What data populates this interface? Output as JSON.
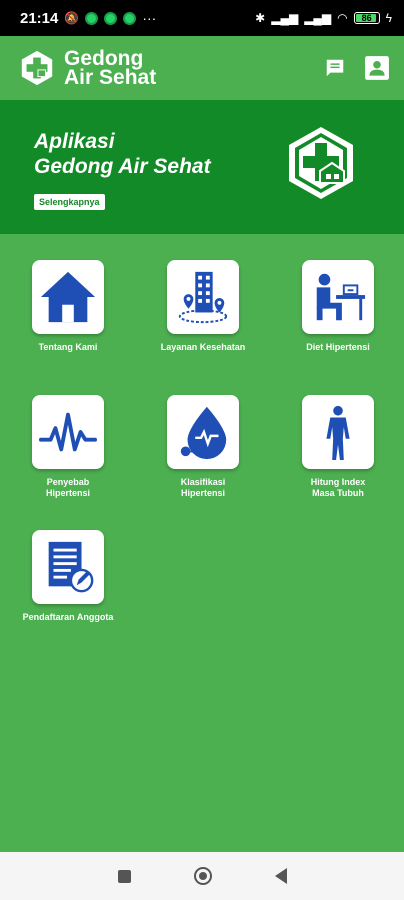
{
  "status_bar": {
    "time": "21:14",
    "battery": "86"
  },
  "app_bar": {
    "title_line1": "Gedong",
    "title_line2": "Air Sehat"
  },
  "banner": {
    "line1": "Aplikasi",
    "line2": "Gedong Air Sehat",
    "button_label": "Selengkapnya"
  },
  "menu": [
    {
      "label": "Tentang Kami",
      "icon": "home-icon"
    },
    {
      "label": "Layanan Kesehatan",
      "icon": "city-location-icon"
    },
    {
      "label": "Diet Hipertensi",
      "icon": "person-at-desk-icon"
    },
    {
      "label": "Penyebab\nHipertensi",
      "icon": "heartbeat-icon"
    },
    {
      "label": "Klasifikasi\nHipertensi",
      "icon": "blood-pressure-drop-icon"
    },
    {
      "label": "Hitung Index\nMasa Tubuh",
      "icon": "human-body-icon"
    },
    {
      "label": "Pendaftaran Anggota",
      "icon": "registration-form-icon"
    }
  ],
  "colors": {
    "primary": "#4caf50",
    "banner": "#138a28",
    "icon_blue": "#1f4fb5"
  }
}
